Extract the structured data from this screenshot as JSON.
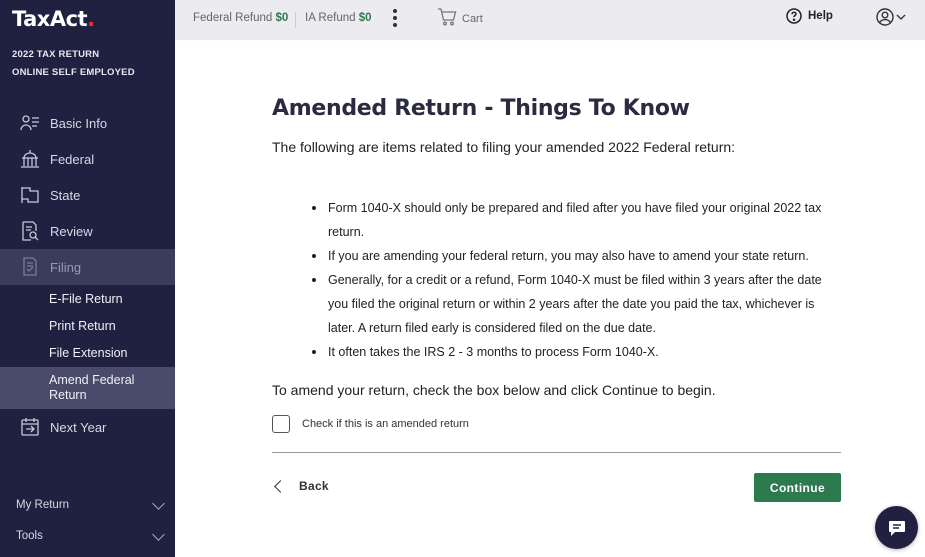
{
  "sidebar": {
    "logo_text": "TaxAct",
    "subtitle_line1": "2022 TAX RETURN",
    "subtitle_line2": "ONLINE SELF EMPLOYED",
    "items": [
      {
        "label": "Basic Info",
        "icon": "person-list-icon"
      },
      {
        "label": "Federal",
        "icon": "capitol-building-icon"
      },
      {
        "label": "State",
        "icon": "state-map-icon"
      },
      {
        "label": "Review",
        "icon": "document-search-icon"
      },
      {
        "label": "Filing",
        "icon": "file-check-icon"
      },
      {
        "label": "Next Year",
        "icon": "calendar-arrow-icon"
      }
    ],
    "filing_subitems": [
      "E-File Return",
      "Print Return",
      "File Extension",
      "Amend Federal Return"
    ],
    "bottom": [
      {
        "label": "My Return"
      },
      {
        "label": "Tools"
      }
    ]
  },
  "header": {
    "federal_refund_label": "Federal Refund",
    "federal_refund_value": "$0",
    "ia_refund_label": "IA Refund",
    "ia_refund_value": "$0",
    "cart_label": "Cart",
    "help_label": "Help"
  },
  "main": {
    "title": "Amended Return - Things To Know",
    "intro": "The following are items related to filing your amended 2022 Federal return:",
    "bullets": [
      "Form 1040-X should only be prepared and filed after you have filed your original 2022 tax return.",
      "If you are amending your federal return, you may also have to amend your state return.",
      "Generally, for a credit or a refund, Form 1040-X must be filed within 3 years after the date you filed the original return or within 2 years after the date you paid the tax, whichever is later. A return filed early is considered filed on the due date.",
      "It often takes the IRS 2 - 3 months to process Form 1040-X."
    ],
    "instruction": "To amend your return, check the box below and click Continue to begin.",
    "checkbox_label": "Check if this is an amended return",
    "checkbox_checked": false,
    "back_label": "Back",
    "continue_label": "Continue"
  },
  "colors": {
    "sidebar_bg": "#202040",
    "accent_green": "#2d7a4e",
    "logo_red": "#e0322f"
  }
}
